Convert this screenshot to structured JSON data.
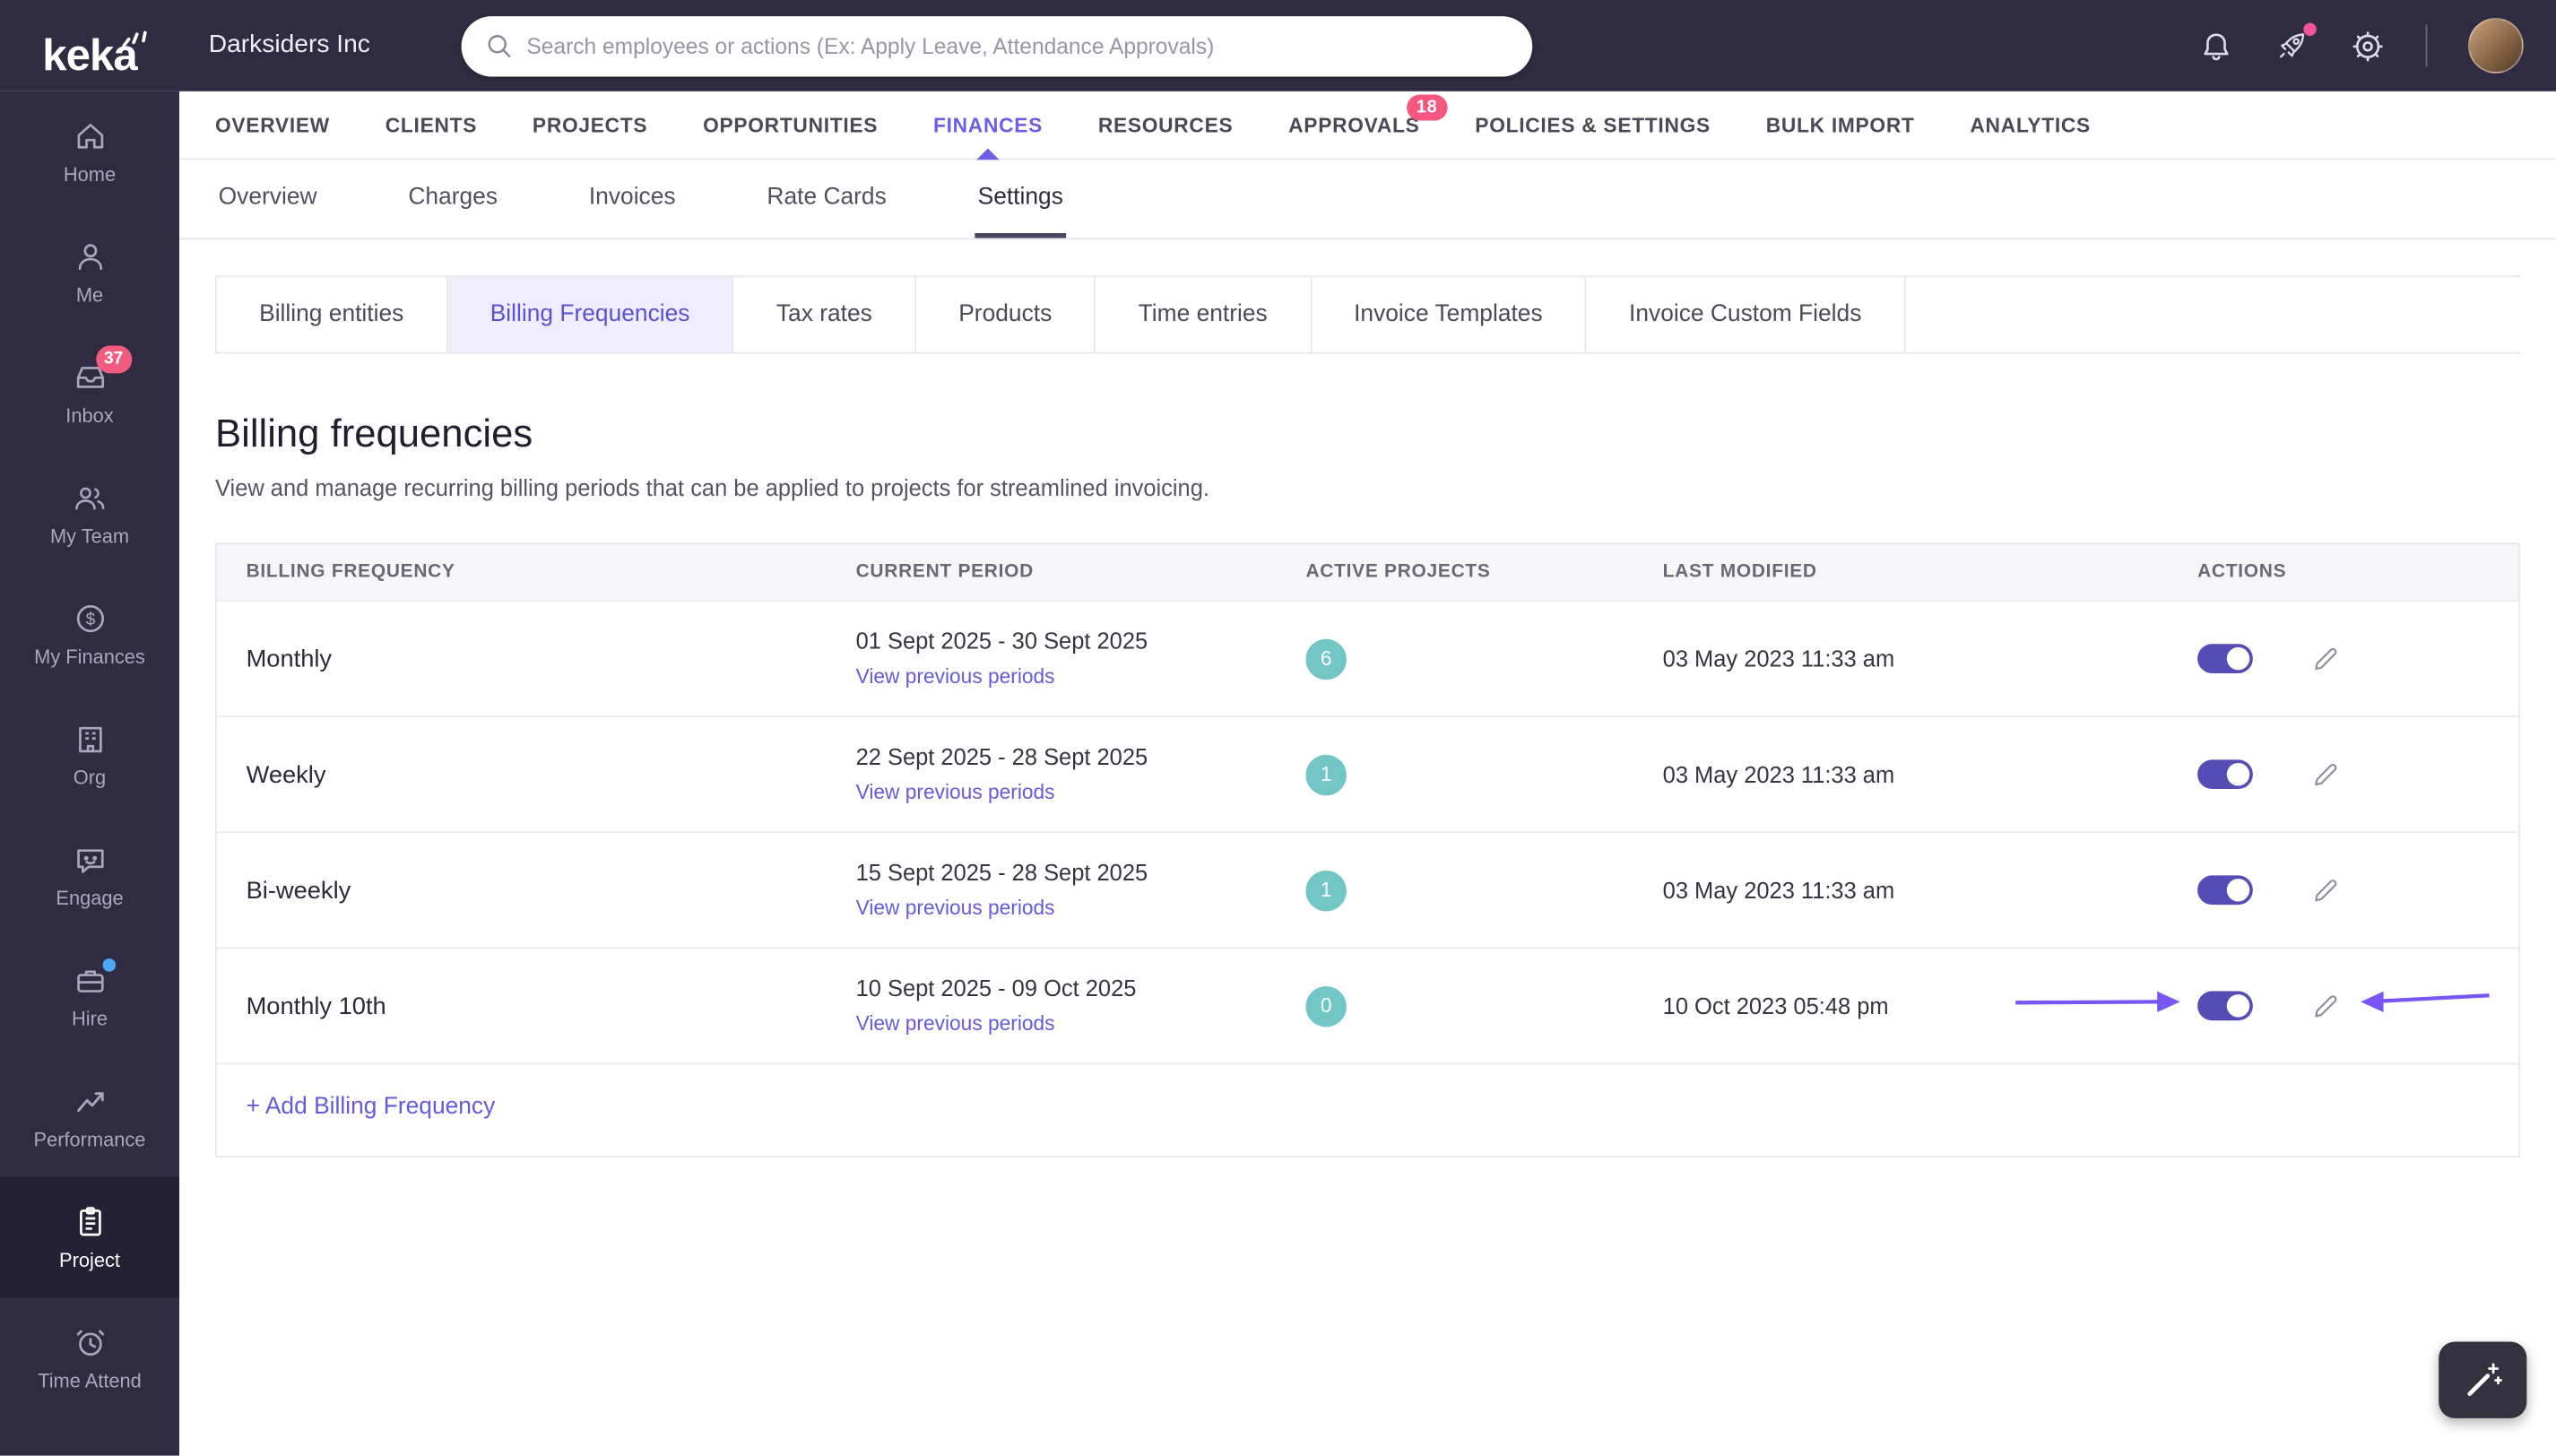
{
  "header": {
    "logo": "keka",
    "company": "Darksiders Inc",
    "search_placeholder": "Search employees or actions (Ex: Apply Leave, Attendance Approvals)"
  },
  "sidebar": {
    "items": [
      {
        "label": "Home"
      },
      {
        "label": "Me"
      },
      {
        "label": "Inbox",
        "badge": "37"
      },
      {
        "label": "My Team"
      },
      {
        "label": "My Finances"
      },
      {
        "label": "Org"
      },
      {
        "label": "Engage"
      },
      {
        "label": "Hire"
      },
      {
        "label": "Performance"
      },
      {
        "label": "Project"
      },
      {
        "label": "Time Attend"
      }
    ]
  },
  "main_nav": {
    "items": [
      {
        "label": "OVERVIEW"
      },
      {
        "label": "CLIENTS"
      },
      {
        "label": "PROJECTS"
      },
      {
        "label": "OPPORTUNITIES"
      },
      {
        "label": "FINANCES"
      },
      {
        "label": "RESOURCES"
      },
      {
        "label": "APPROVALS",
        "badge": "18"
      },
      {
        "label": "POLICIES & SETTINGS"
      },
      {
        "label": "BULK IMPORT"
      },
      {
        "label": "ANALYTICS"
      }
    ]
  },
  "sub_nav": {
    "items": [
      {
        "label": "Overview"
      },
      {
        "label": "Charges"
      },
      {
        "label": "Invoices"
      },
      {
        "label": "Rate Cards"
      },
      {
        "label": "Settings"
      }
    ]
  },
  "settings_tabs": {
    "items": [
      {
        "label": "Billing entities"
      },
      {
        "label": "Billing Frequencies"
      },
      {
        "label": "Tax rates"
      },
      {
        "label": "Products"
      },
      {
        "label": "Time entries"
      },
      {
        "label": "Invoice Templates"
      },
      {
        "label": "Invoice Custom Fields"
      }
    ]
  },
  "page": {
    "title": "Billing frequencies",
    "description": "View and manage recurring billing periods that can be applied to projects for streamlined invoicing.",
    "add_link": "+ Add Billing Frequency"
  },
  "table": {
    "headers": [
      "BILLING FREQUENCY",
      "CURRENT PERIOD",
      "ACTIVE PROJECTS",
      "LAST MODIFIED",
      "ACTIONS"
    ],
    "view_previous_label": "View previous periods",
    "rows": [
      {
        "frequency": "Monthly",
        "period": "01 Sept 2025 - 30 Sept 2025",
        "active_projects": "6",
        "last_modified": "03 May 2023 11:33 am",
        "toggle_on": true
      },
      {
        "frequency": "Weekly",
        "period": "22 Sept 2025 - 28 Sept 2025",
        "active_projects": "1",
        "last_modified": "03 May 2023 11:33 am",
        "toggle_on": true
      },
      {
        "frequency": "Bi-weekly",
        "period": "15 Sept 2025 - 28 Sept 2025",
        "active_projects": "1",
        "last_modified": "03 May 2023 11:33 am",
        "toggle_on": true
      },
      {
        "frequency": "Monthly 10th",
        "period": "10 Sept 2025 - 09 Oct 2025",
        "active_projects": "0",
        "last_modified": "10 Oct 2023 05:48 pm",
        "toggle_on": true,
        "annotated": true
      }
    ]
  },
  "icons": {
    "search-icon": "magnifier",
    "bell-icon": "bell",
    "rocket-icon": "rocket",
    "gear-icon": "gear",
    "home-icon": "house",
    "me-icon": "person",
    "inbox-icon": "tray",
    "team-icon": "people",
    "finances-icon": "dollar-circle",
    "org-icon": "building",
    "engage-icon": "chat-bubble",
    "hire-icon": "briefcase",
    "performance-icon": "trend-line",
    "project-icon": "clipboard",
    "time-attend-icon": "alarm-clock",
    "edit-icon": "pencil",
    "ai-assistant-icon": "magic-wand"
  },
  "colors": {
    "topbar_bg": "#2F2C41",
    "sidebar_active_bg": "#242135",
    "accent_purple": "#6E5EE4",
    "active_tab_bg": "#EFEDFB",
    "toggle_on": "#564CB5",
    "annotation_arrow": "#7A55F6",
    "active_projects_badge": "#72C6C5",
    "notification_red": "#F4587E",
    "link_purple": "#6759D8"
  }
}
